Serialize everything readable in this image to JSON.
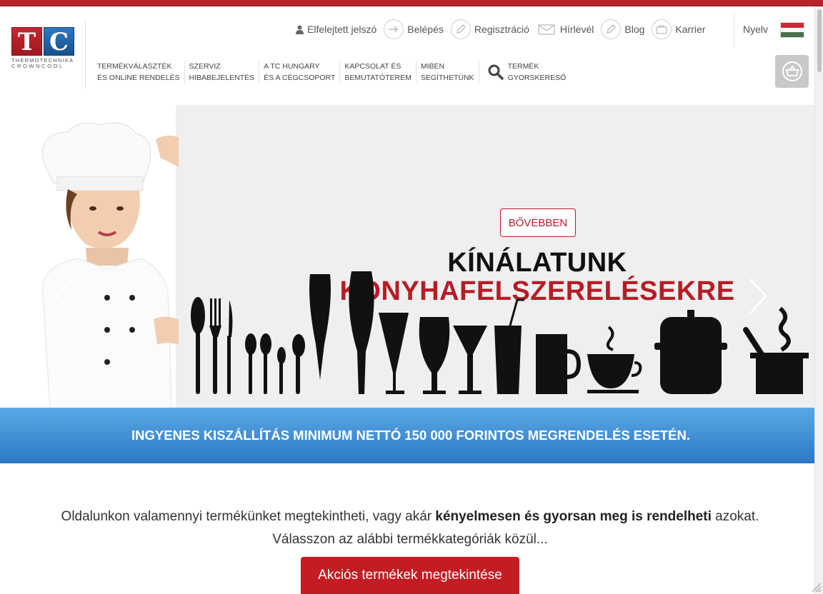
{
  "logo": {
    "letter1": "T",
    "letter2": "C",
    "line1": "THERMOTECHNIKA",
    "line2": "CROWNCOOL"
  },
  "top_links": [
    {
      "label": "Elfelejtett jelszó",
      "icon": "user-icon"
    },
    {
      "label": "Belépés",
      "icon": "login-arrow-icon"
    },
    {
      "label": "Regisztráció",
      "icon": "pencil-icon"
    },
    {
      "label": "Hírlevél",
      "icon": "envelope-icon"
    },
    {
      "label": "Blog",
      "icon": "pencil-icon"
    },
    {
      "label": "Karrier",
      "icon": "briefcase-icon"
    }
  ],
  "language": {
    "label": "Nyelv",
    "flag_colors": [
      "#ce2939",
      "#ffffff",
      "#477050"
    ]
  },
  "nav": [
    {
      "line1": "Termékválaszték",
      "line2": "és online rendelés"
    },
    {
      "line1": "Szerviz",
      "line2": "hibabejelentés"
    },
    {
      "line1": "A TC Hungary",
      "line2": "és a cégcsoport"
    },
    {
      "line1": "Kapcsolat és",
      "line2": "bemutatóterem"
    },
    {
      "line1": "Miben",
      "line2": "segíthetünk"
    },
    {
      "line1": "Termék",
      "line2": "gyorskereső"
    }
  ],
  "hero": {
    "title1": "KÍNÁLATUNK",
    "title2": "KONYHAFELSZERELÉSEKRE",
    "button": "BŐVEBBEN"
  },
  "shipping_banner": "INGYENES KISZÁLLÍTÁS MINIMUM NETTÓ 150 000 FORINTOS MEGRENDELÉS ESETÉN.",
  "intro": {
    "part1": "Oldalunkon valamennyi termékünket megtekintheti, vagy akár ",
    "bold": "kényelmesen és gyorsan meg is rendelheti",
    "part2": " azokat.",
    "line2": "Válasszon az alábbi termékkategóriák közül..."
  },
  "promo_button": "Akciós termékek megtekintése",
  "colors": {
    "brand_red": "#b71c26",
    "banner_blue": "#3a8ad3"
  }
}
